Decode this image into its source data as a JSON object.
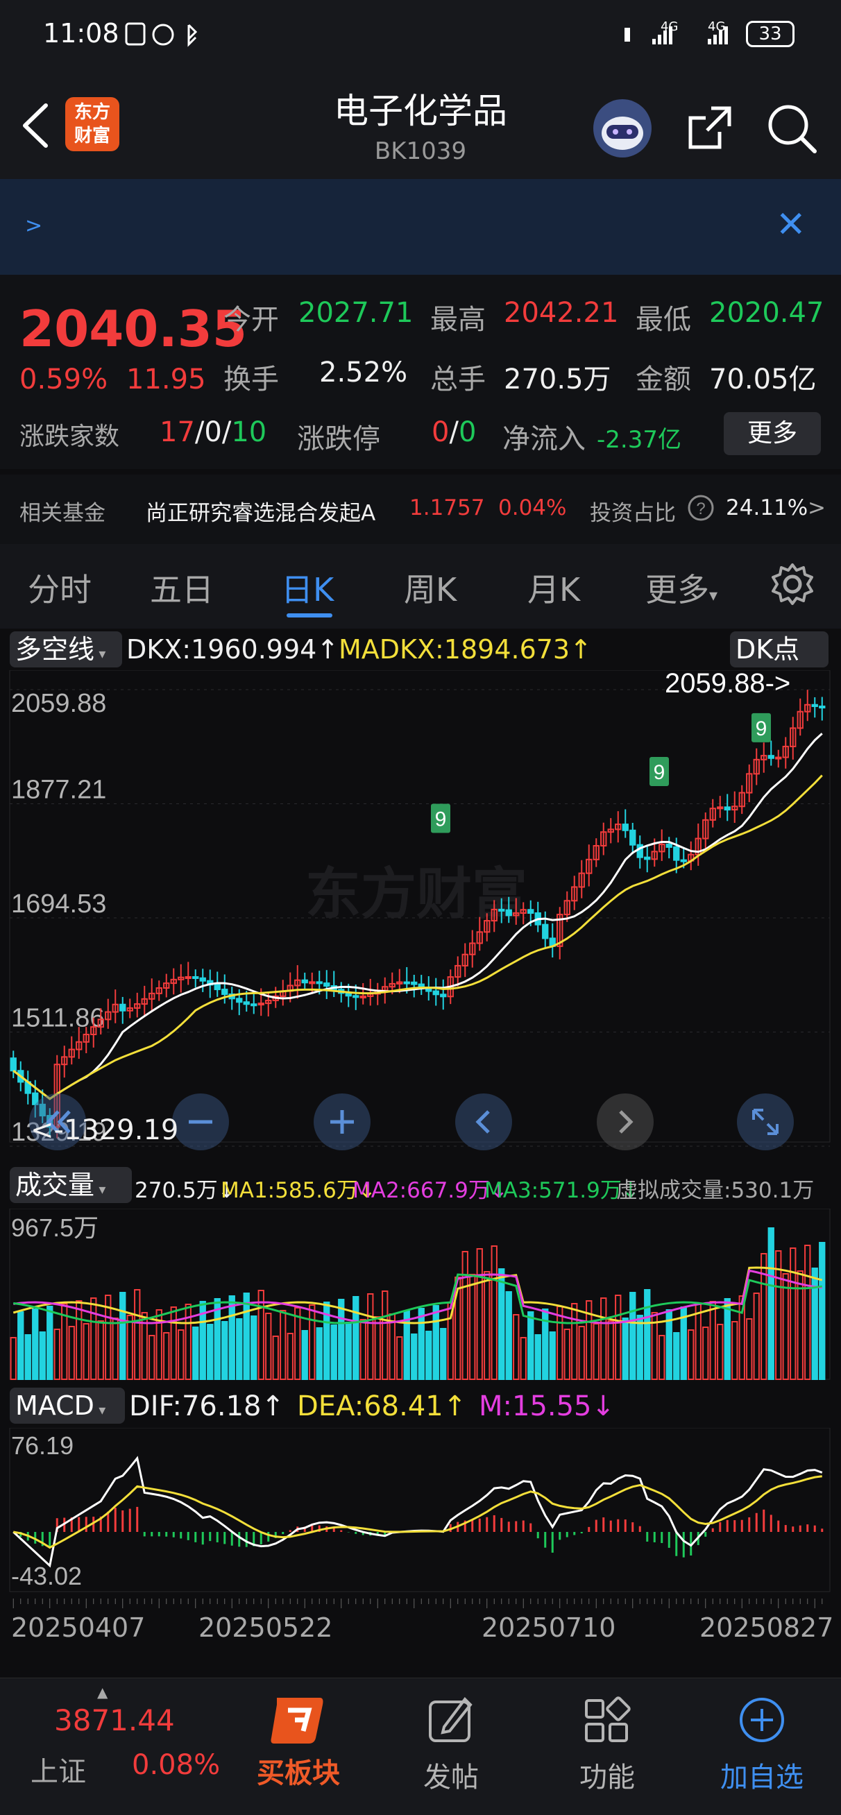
{
  "status_bar": {
    "time": "11:08",
    "signal1": "4G",
    "signal2": "4G",
    "battery": "33"
  },
  "nav": {
    "back_icon": "chevron-left-icon",
    "logo_line1": "东方",
    "logo_line2": "财富",
    "title": "电子化学品",
    "code": "BK1039",
    "share_icon": "share-icon",
    "search_icon": "search-icon"
  },
  "banner": {
    "text": ">",
    "close": "✕"
  },
  "quote": {
    "price": "2040.35",
    "change_pct": "0.59%",
    "change_amt": "11.95",
    "open_label": "今开",
    "open": "2027.71",
    "high_label": "最高",
    "high": "2042.21",
    "low_label": "最低",
    "low": "2020.47",
    "turnover_label": "换手",
    "turnover": "2.52%",
    "volume_label": "总手",
    "volume": "270.5万",
    "amount_label": "金额",
    "amount": "70.05亿",
    "updown_label": "涨跌家数",
    "up": "17",
    "flat": "0",
    "down": "10",
    "limit_label": "涨跌停",
    "limit_up": "0",
    "limit_down": "0",
    "netflow_label": "净流入",
    "netflow": "-2.37亿",
    "more_button": "更多"
  },
  "fund": {
    "label": "相关基金",
    "name": "尚正研究睿选混合发起A",
    "nav": "1.1757",
    "change": "0.04%",
    "ratio_label": "投资占比",
    "ratio": "24.11%",
    "arrow": ">"
  },
  "tabs": [
    {
      "label": "分时"
    },
    {
      "label": "五日"
    },
    {
      "label": "日K"
    },
    {
      "label": "周K"
    },
    {
      "label": "月K"
    },
    {
      "label": "更多"
    }
  ],
  "indicators": {
    "main_selector": "多空线",
    "dkx": "DKX:1960.994↑",
    "madkx": "MADKX:1894.673↑",
    "dk_button": "DK点",
    "y_labels": [
      "2059.88",
      "1877.21",
      "1694.53",
      "1511.86",
      "1329.19"
    ],
    "max_marker": "2059.88->",
    "min_marker": "<-1329.19",
    "watermark": "东方财富"
  },
  "volume": {
    "selector": "成交量",
    "vol": "270.5万↓",
    "ma1": "MA1:585.6万↓",
    "ma2": "MA2:667.9万↓",
    "ma3": "MA3:571.9万↓",
    "virtual": "虚拟成交量:530.1万",
    "max_label": "967.5万"
  },
  "macd": {
    "selector": "MACD",
    "dif": "DIF:76.18↑",
    "dea": "DEA:68.41↑",
    "m": "M:15.55↓",
    "top_label": "76.19",
    "bottom_label": "-43.02"
  },
  "dates": [
    "20250407",
    "20250522",
    "20250710",
    "20250827"
  ],
  "bottom_nav": {
    "index_value": "3871.44",
    "index_name": "上证",
    "index_change": "0.08%",
    "buy_board": "买板块",
    "post": "发帖",
    "functions": "功能",
    "add_fav": "加自选"
  },
  "colors": {
    "up": "#f23c3c",
    "down": "#1ec95a",
    "accent": "#3f8ff0",
    "candle_down": "#22d3e0"
  }
}
